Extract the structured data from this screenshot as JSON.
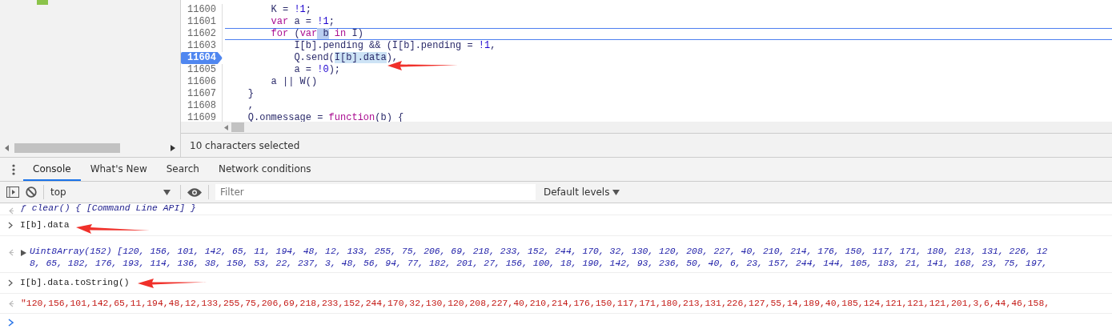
{
  "source": {
    "lines": [
      {
        "number": "11600",
        "current": false,
        "breakpoint": false,
        "tokens": [
          {
            "t": "        K =",
            "kind": "plain"
          },
          {
            "t": " !1",
            "kind": "num"
          },
          {
            "t": ";",
            "kind": "plain"
          }
        ]
      },
      {
        "number": "11601",
        "current": false,
        "breakpoint": false,
        "tokens": [
          {
            "t": "        var",
            "kind": "kw"
          },
          {
            "t": " a =",
            "kind": "plain"
          },
          {
            "t": " !1",
            "kind": "num"
          },
          {
            "t": ";",
            "kind": "plain"
          }
        ]
      },
      {
        "number": "11602",
        "current": true,
        "breakpoint": false,
        "tokens": [
          {
            "t": "        for",
            "kind": "kw"
          },
          {
            "t": " (",
            "kind": "plain"
          },
          {
            "t": "var",
            "kind": "kw"
          },
          {
            "t": " b",
            "kind": "match"
          },
          {
            "t": " in",
            "kind": "kw"
          },
          {
            "t": " I)",
            "kind": "plain"
          }
        ]
      },
      {
        "number": "11603",
        "current": false,
        "breakpoint": false,
        "tokens": [
          {
            "t": "            I[b].pending && (I[b].pending =",
            "kind": "plain"
          },
          {
            "t": " !1",
            "kind": "num"
          },
          {
            "t": ",",
            "kind": "plain"
          }
        ]
      },
      {
        "number": "11604",
        "current": false,
        "breakpoint": true,
        "tokens": [
          {
            "t": "            Q.send(",
            "kind": "plain"
          },
          {
            "t": "I[b].data",
            "kind": "sel"
          },
          {
            "t": "),",
            "kind": "plain"
          }
        ]
      },
      {
        "number": "11605",
        "current": false,
        "breakpoint": false,
        "tokens": [
          {
            "t": "            a =",
            "kind": "plain"
          },
          {
            "t": " !0",
            "kind": "num"
          },
          {
            "t": ");",
            "kind": "plain"
          }
        ]
      },
      {
        "number": "11606",
        "current": false,
        "breakpoint": false,
        "tokens": [
          {
            "t": "        a || W()",
            "kind": "plain"
          }
        ]
      },
      {
        "number": "11607",
        "current": false,
        "breakpoint": false,
        "tokens": [
          {
            "t": "    }",
            "kind": "plain"
          }
        ]
      },
      {
        "number": "11608",
        "current": false,
        "breakpoint": false,
        "tokens": [
          {
            "t": "    ,",
            "kind": "plain"
          }
        ]
      },
      {
        "number": "11609",
        "current": false,
        "breakpoint": false,
        "tokens": [
          {
            "t": "    Q.onmessage =",
            "kind": "plain"
          },
          {
            "t": " function",
            "kind": "kw"
          },
          {
            "t": "(b) {",
            "kind": "plain"
          }
        ]
      }
    ]
  },
  "status_bar": "10 characters selected",
  "drawer_tabs": [
    {
      "label": "Console",
      "selected": true
    },
    {
      "label": "What's New",
      "selected": false
    },
    {
      "label": "Search",
      "selected": false
    },
    {
      "label": "Network conditions",
      "selected": false
    }
  ],
  "toolbar": {
    "context": "top",
    "filter_placeholder": "Filter",
    "levels": "Default levels"
  },
  "console": [
    {
      "kind": "function",
      "lines": [
        "ƒ clear() { [Command Line API] }"
      ]
    },
    {
      "kind": "command",
      "lines": [
        "I[b].data"
      ]
    },
    {
      "kind": "object",
      "lines": [
        "Uint8Array(152) [120, 156, 101, 142, 65, 11, 194, 48, 12, 133, 255, 75, 206, 69, 218, 233, 152, 244, 170, 32, 130, 120, 208, 227, 40, 210, 214, 176, 150, 117, 171, 180, 213, 131, 226, 12",
        "8, 65, 182, 176, 193, 114, 136, 38, 150, 53, 22, 237, 3, 48, 56, 94, 77, 182, 201, 27, 156, 100, 18, 190, 142, 93, 236, 50, 40, 6, 23, 157, 244, 144, 105, 183, 21, 141, 168, 23, 75, 197,"
      ]
    },
    {
      "kind": "command",
      "lines": [
        "I[b].data.toString()"
      ]
    },
    {
      "kind": "string",
      "lines": [
        "\"120,156,101,142,65,11,194,48,12,133,255,75,206,69,218,233,152,244,170,32,130,120,208,227,40,210,214,176,150,117,171,180,213,131,226,127,55,14,189,40,185,124,121,121,121,201,3,6,44,46,158,"
      ]
    }
  ]
}
